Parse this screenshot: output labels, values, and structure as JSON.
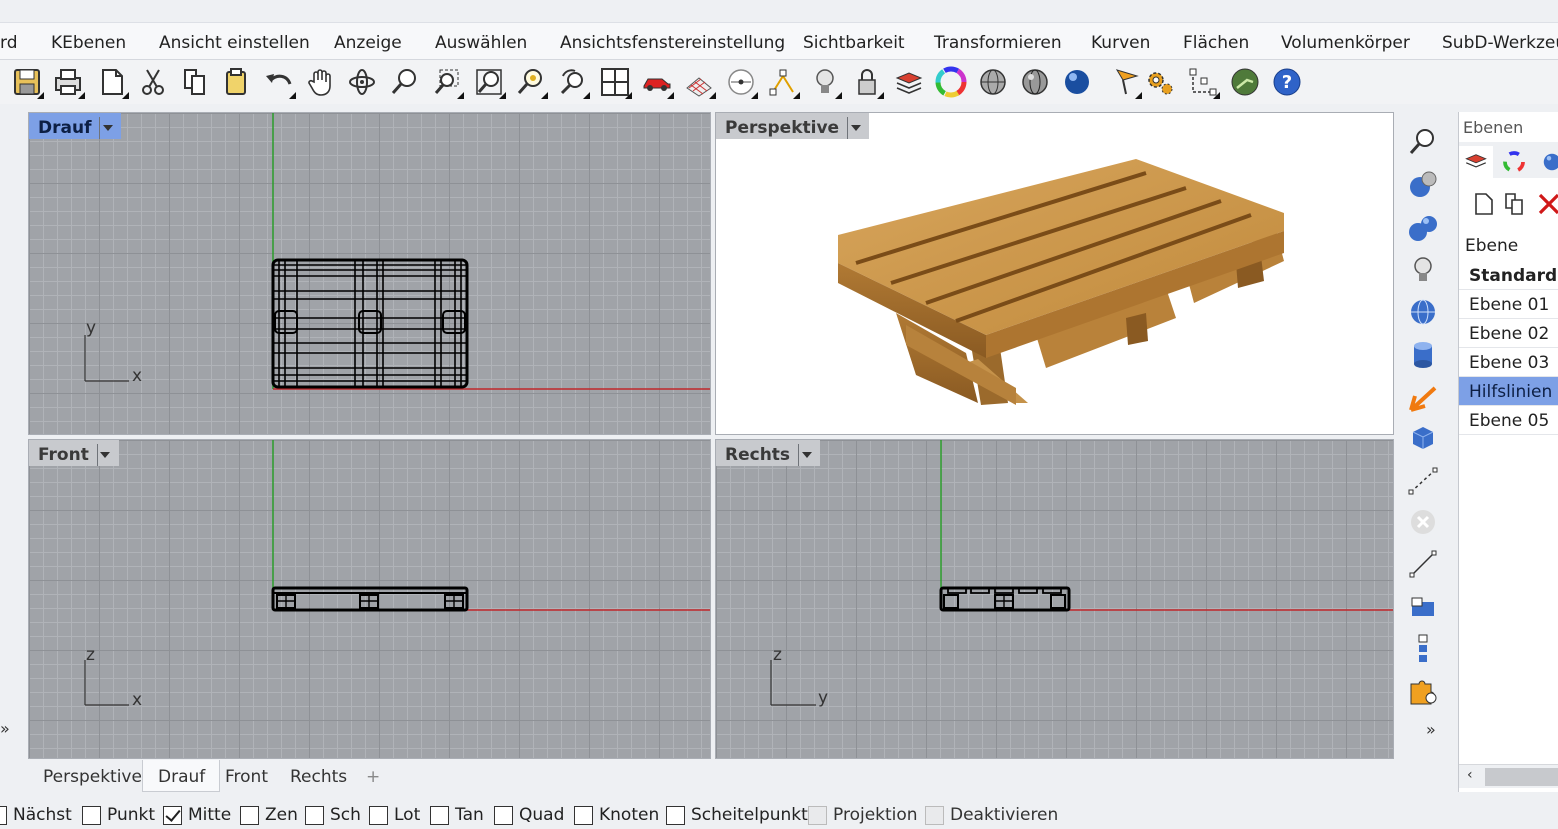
{
  "menu_tabs": [
    {
      "label": "rd",
      "active": true
    },
    {
      "label": "KEbenen"
    },
    {
      "label": "Ansicht einstellen"
    },
    {
      "label": "Anzeige"
    },
    {
      "label": "Auswählen"
    },
    {
      "label": "Ansichtsfenstereinstellung"
    },
    {
      "label": "Sichtbarkeit"
    },
    {
      "label": "Transformieren"
    },
    {
      "label": "Kurven"
    },
    {
      "label": "Flächen"
    },
    {
      "label": "Volumenkörper"
    },
    {
      "label": "SubD-Werkzeu"
    }
  ],
  "toolbar_icons": [
    "save-icon",
    "print-icon",
    "new-document-icon",
    "cut-icon",
    "copy-icon",
    "paste-icon",
    "undo-icon",
    "pan-hand-icon",
    "rotate-view-icon",
    "zoom-icon",
    "zoom-window-icon",
    "zoom-extents-icon",
    "zoom-selected-icon",
    "undo-view-icon",
    "four-viewports-icon",
    "car-icon",
    "grid-snap-icon",
    "point-icon",
    "curve-points-icon",
    "light-bulb-icon",
    "lock-icon",
    "layer-icon",
    "color-wheel-icon",
    "wireframe-sphere-icon",
    "shaded-sphere-icon",
    "rendered-sphere-icon",
    "render-icon",
    "settings-gear-icon",
    "dimension-icon",
    "grasshopper-icon",
    "help-icon"
  ],
  "viewports": {
    "top": {
      "label": "Drauf",
      "axis_h": "x",
      "axis_v": "y"
    },
    "perspective": {
      "label": "Perspektive"
    },
    "front": {
      "label": "Front",
      "axis_h": "x",
      "axis_v": "z"
    },
    "right": {
      "label": "Rechts",
      "axis_h": "y",
      "axis_v": "z"
    }
  },
  "right_toolbar_icons": [
    "zoom-icon",
    "sphere-icon",
    "spheres-icon",
    "light-bulb-icon",
    "globe-icon",
    "cylinder-icon",
    "arrow-icon",
    "cube-icon",
    "polyline-icon",
    "cancel-icon",
    "line-icon",
    "box-icon",
    "stack-icon",
    "puzzle-icon"
  ],
  "layers_panel": {
    "title": "Ebenen",
    "column_header": "Ebene",
    "layers": [
      {
        "name": "Standard",
        "bold": true
      },
      {
        "name": "Ebene 01"
      },
      {
        "name": "Ebene 02"
      },
      {
        "name": "Ebene 03"
      },
      {
        "name": "Hilfslinien",
        "selected": true
      },
      {
        "name": "Ebene 05"
      }
    ]
  },
  "viewport_tabs": [
    "Perspektive",
    "Drauf",
    "Front",
    "Rechts"
  ],
  "current_viewport_tab": "Drauf",
  "add_tab_symbol": "+",
  "more_symbol": "»",
  "osnaps": [
    {
      "label": "Nächst",
      "checked": false
    },
    {
      "label": "Punkt",
      "checked": false
    },
    {
      "label": "Mitte",
      "checked": true
    },
    {
      "label": "Zen",
      "checked": false
    },
    {
      "label": "Sch",
      "checked": false
    },
    {
      "label": "Lot",
      "checked": false
    },
    {
      "label": "Tan",
      "checked": false
    },
    {
      "label": "Quad",
      "checked": false
    },
    {
      "label": "Knoten",
      "checked": false
    },
    {
      "label": "Scheitelpunkt",
      "checked": false
    },
    {
      "label": "Projektion",
      "checked": false,
      "disabled": true
    },
    {
      "label": "Deaktivieren",
      "checked": false,
      "disabled": true
    }
  ],
  "colors": {
    "accent": "#7da0e6",
    "x_axis": "#c0282a",
    "y_axis": "#2a9c2a",
    "wood": "#c99548"
  }
}
